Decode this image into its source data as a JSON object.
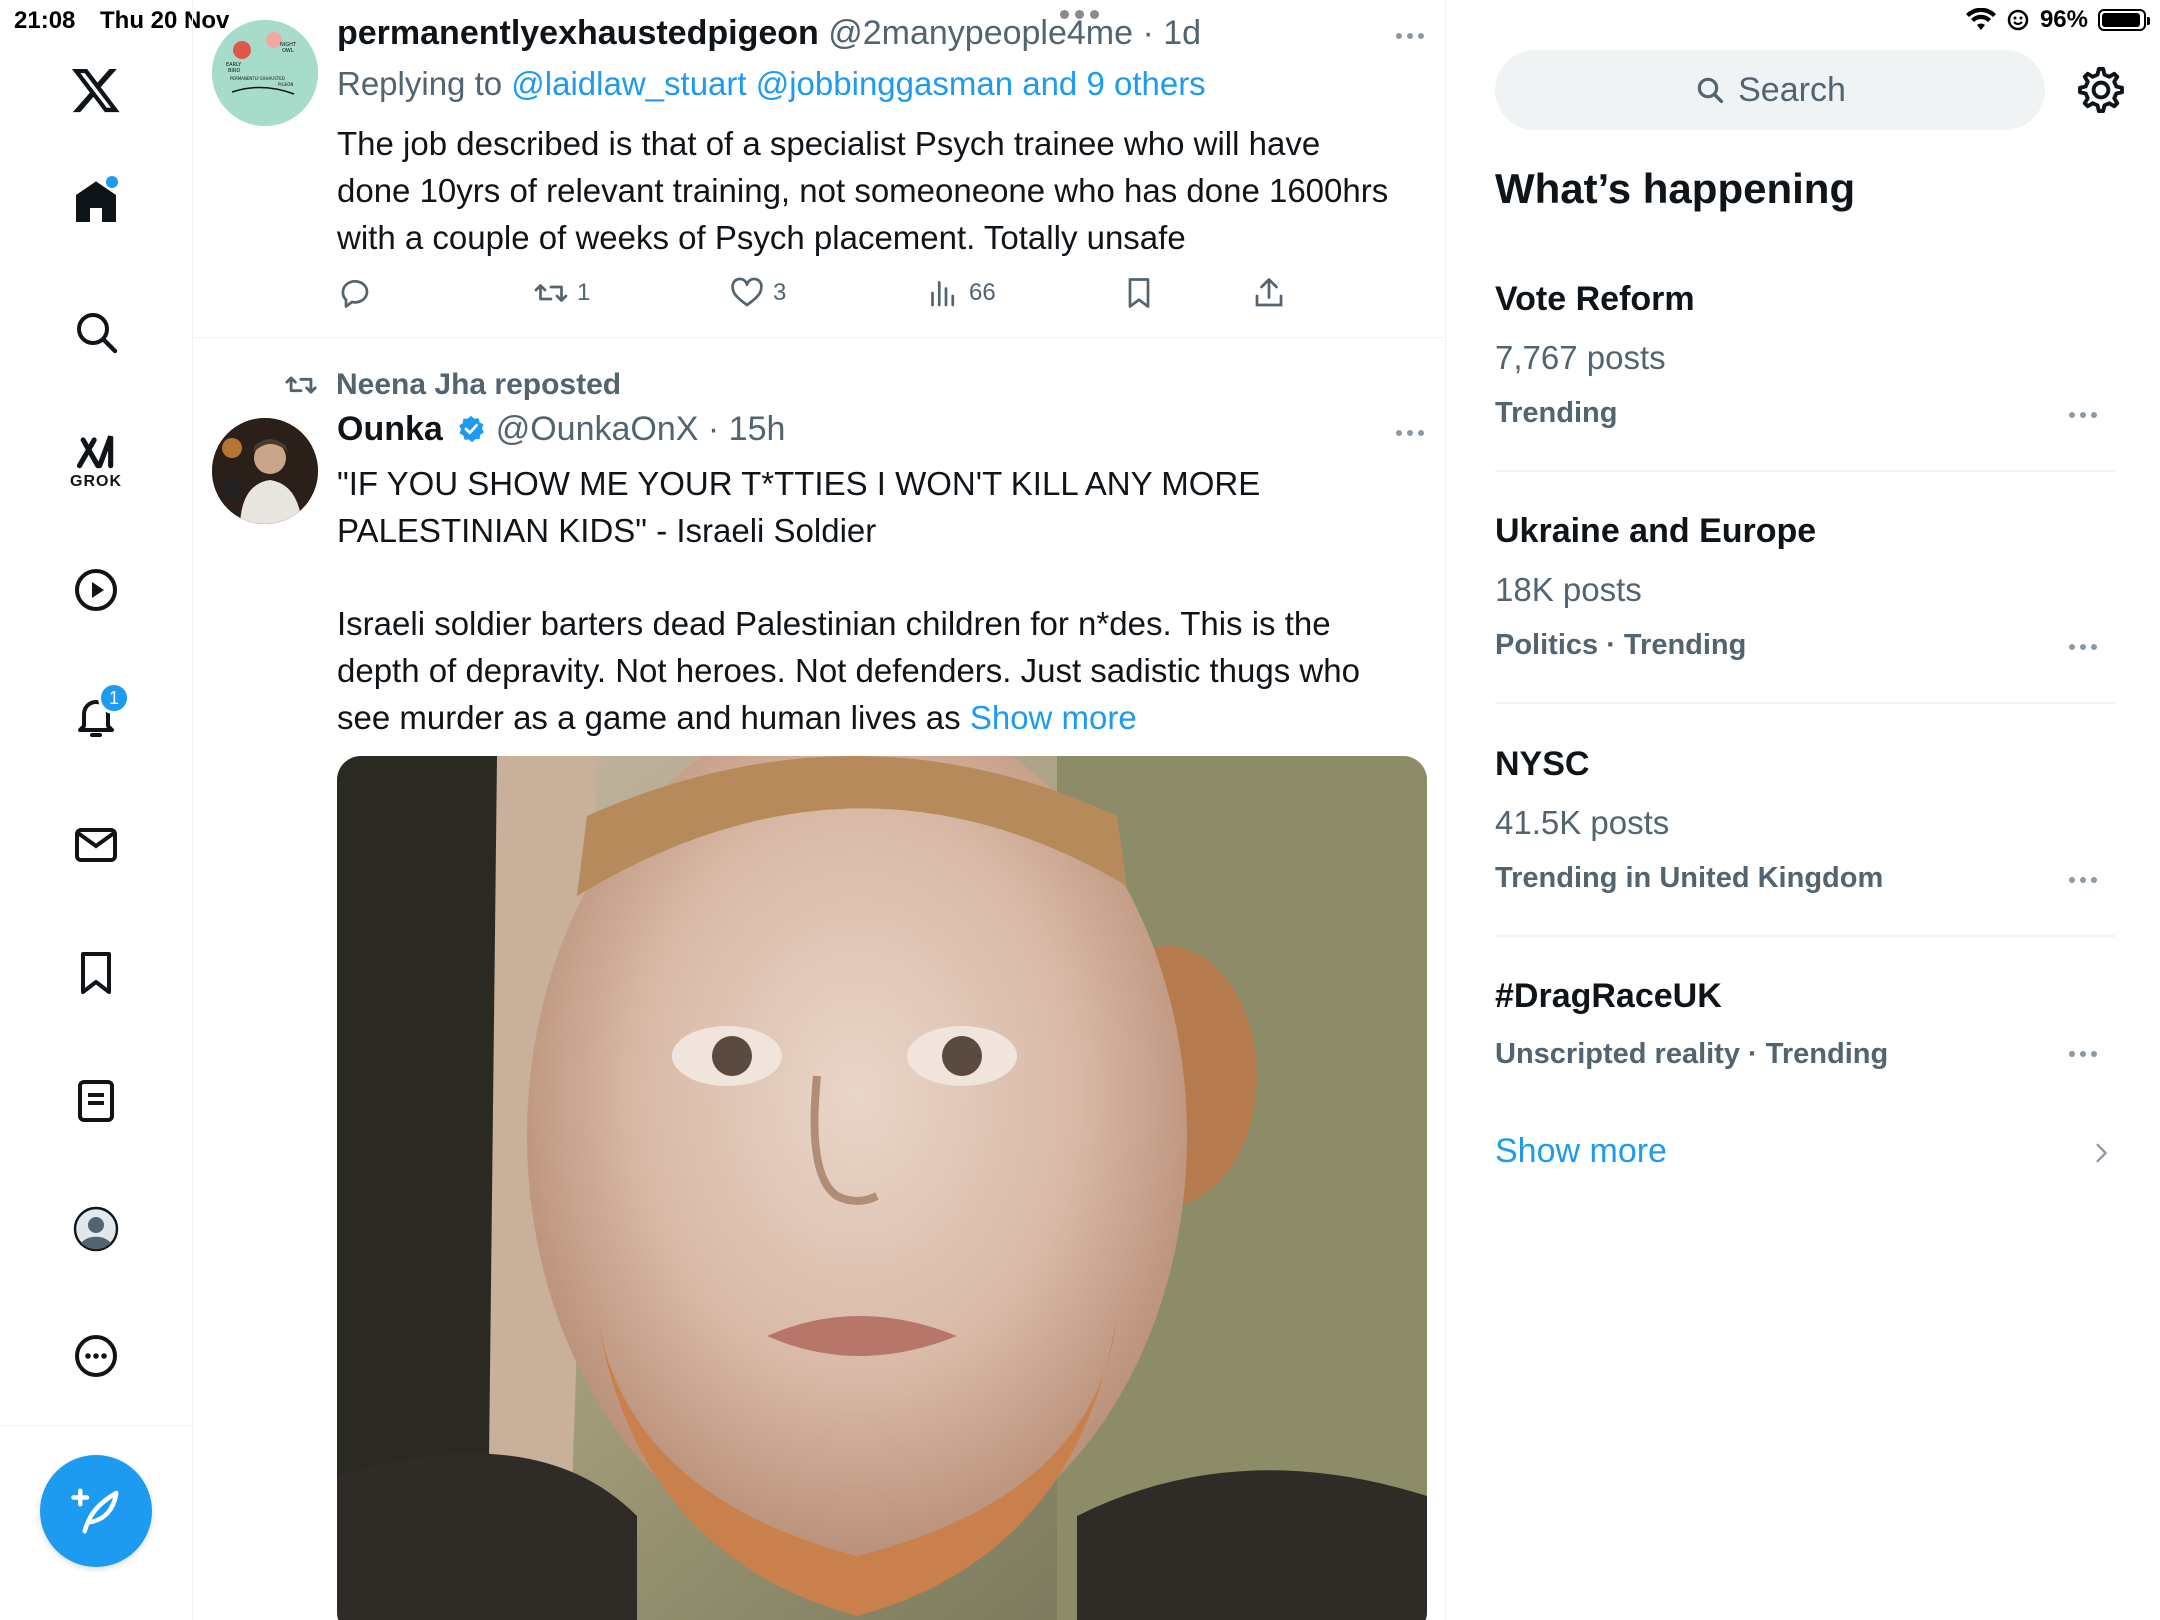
{
  "status_bar": {
    "time": "21:08",
    "date": "Thu 20 Nov",
    "battery": "96%",
    "battery_level": 0.96
  },
  "nav": {
    "grok_label": "GROK",
    "notifications_badge": "1",
    "icons": [
      "x-logo-icon",
      "home-icon",
      "search-icon",
      "grok-icon",
      "video-icon",
      "bell-icon",
      "mail-icon",
      "bookmark-icon",
      "lists-icon",
      "profile-icon",
      "more-icon",
      "compose-icon"
    ]
  },
  "tweet1": {
    "name": "permanentlyexhaustedpigeon",
    "handle": "@2manypeople4me",
    "time": "· 1d",
    "replying_prefix": "Replying to",
    "replying_to": "@laidlaw_stuart @jobbinggasman and 9 others",
    "text_lines": [
      "The job described is that of a specialist Psych trainee who will have",
      "done 10yrs of relevant training, not someoneone who has done 1600hrs",
      "with a couple of weeks of Psych placement. Totally unsafe"
    ],
    "avatar_text": [
      "NIGHT",
      "OWL",
      "EARLY",
      "BIRD",
      "PERMANENTLY EXHAUSTED",
      "PIGEON"
    ],
    "retweets": "1",
    "likes": "3",
    "views": "66"
  },
  "tweet2": {
    "reposted_by": "Neena Jha reposted",
    "name": "Ounka",
    "handle": "@OunkaOnX",
    "time": "· 15h",
    "text_lines_a": [
      "\"IF YOU SHOW ME YOUR T*TTIES I WON'T KILL ANY MORE",
      "PALESTINIAN KIDS\" - Israeli Soldier"
    ],
    "text_lines_b": [
      "Israeli soldier barters dead Palestinian children for n*des. This is the",
      "depth of depravity. Not heroes. Not defenders. Just sadistic thugs who"
    ],
    "text_line_c": "see murder as a game and human lives as",
    "show_more": "Show more"
  },
  "right": {
    "search_placeholder": "Search",
    "section_title": "What’s happening",
    "trends": [
      {
        "title": "Vote Reform",
        "posts": "7,767 posts",
        "meta": "Trending"
      },
      {
        "title": "Ukraine and Europe",
        "posts": "18K posts",
        "meta": "Politics · Trending"
      },
      {
        "title": "NYSC",
        "posts": "41.5K posts",
        "meta": "Trending in United Kingdom"
      },
      {
        "title": "#DragRaceUK",
        "posts": "",
        "meta": "Unscripted reality · Trending"
      }
    ],
    "show_more": "Show more"
  },
  "colors": {
    "accent": "#1d9bf0",
    "text": "#0f1419",
    "secondary": "#536471",
    "divider": "#eff3f4"
  }
}
